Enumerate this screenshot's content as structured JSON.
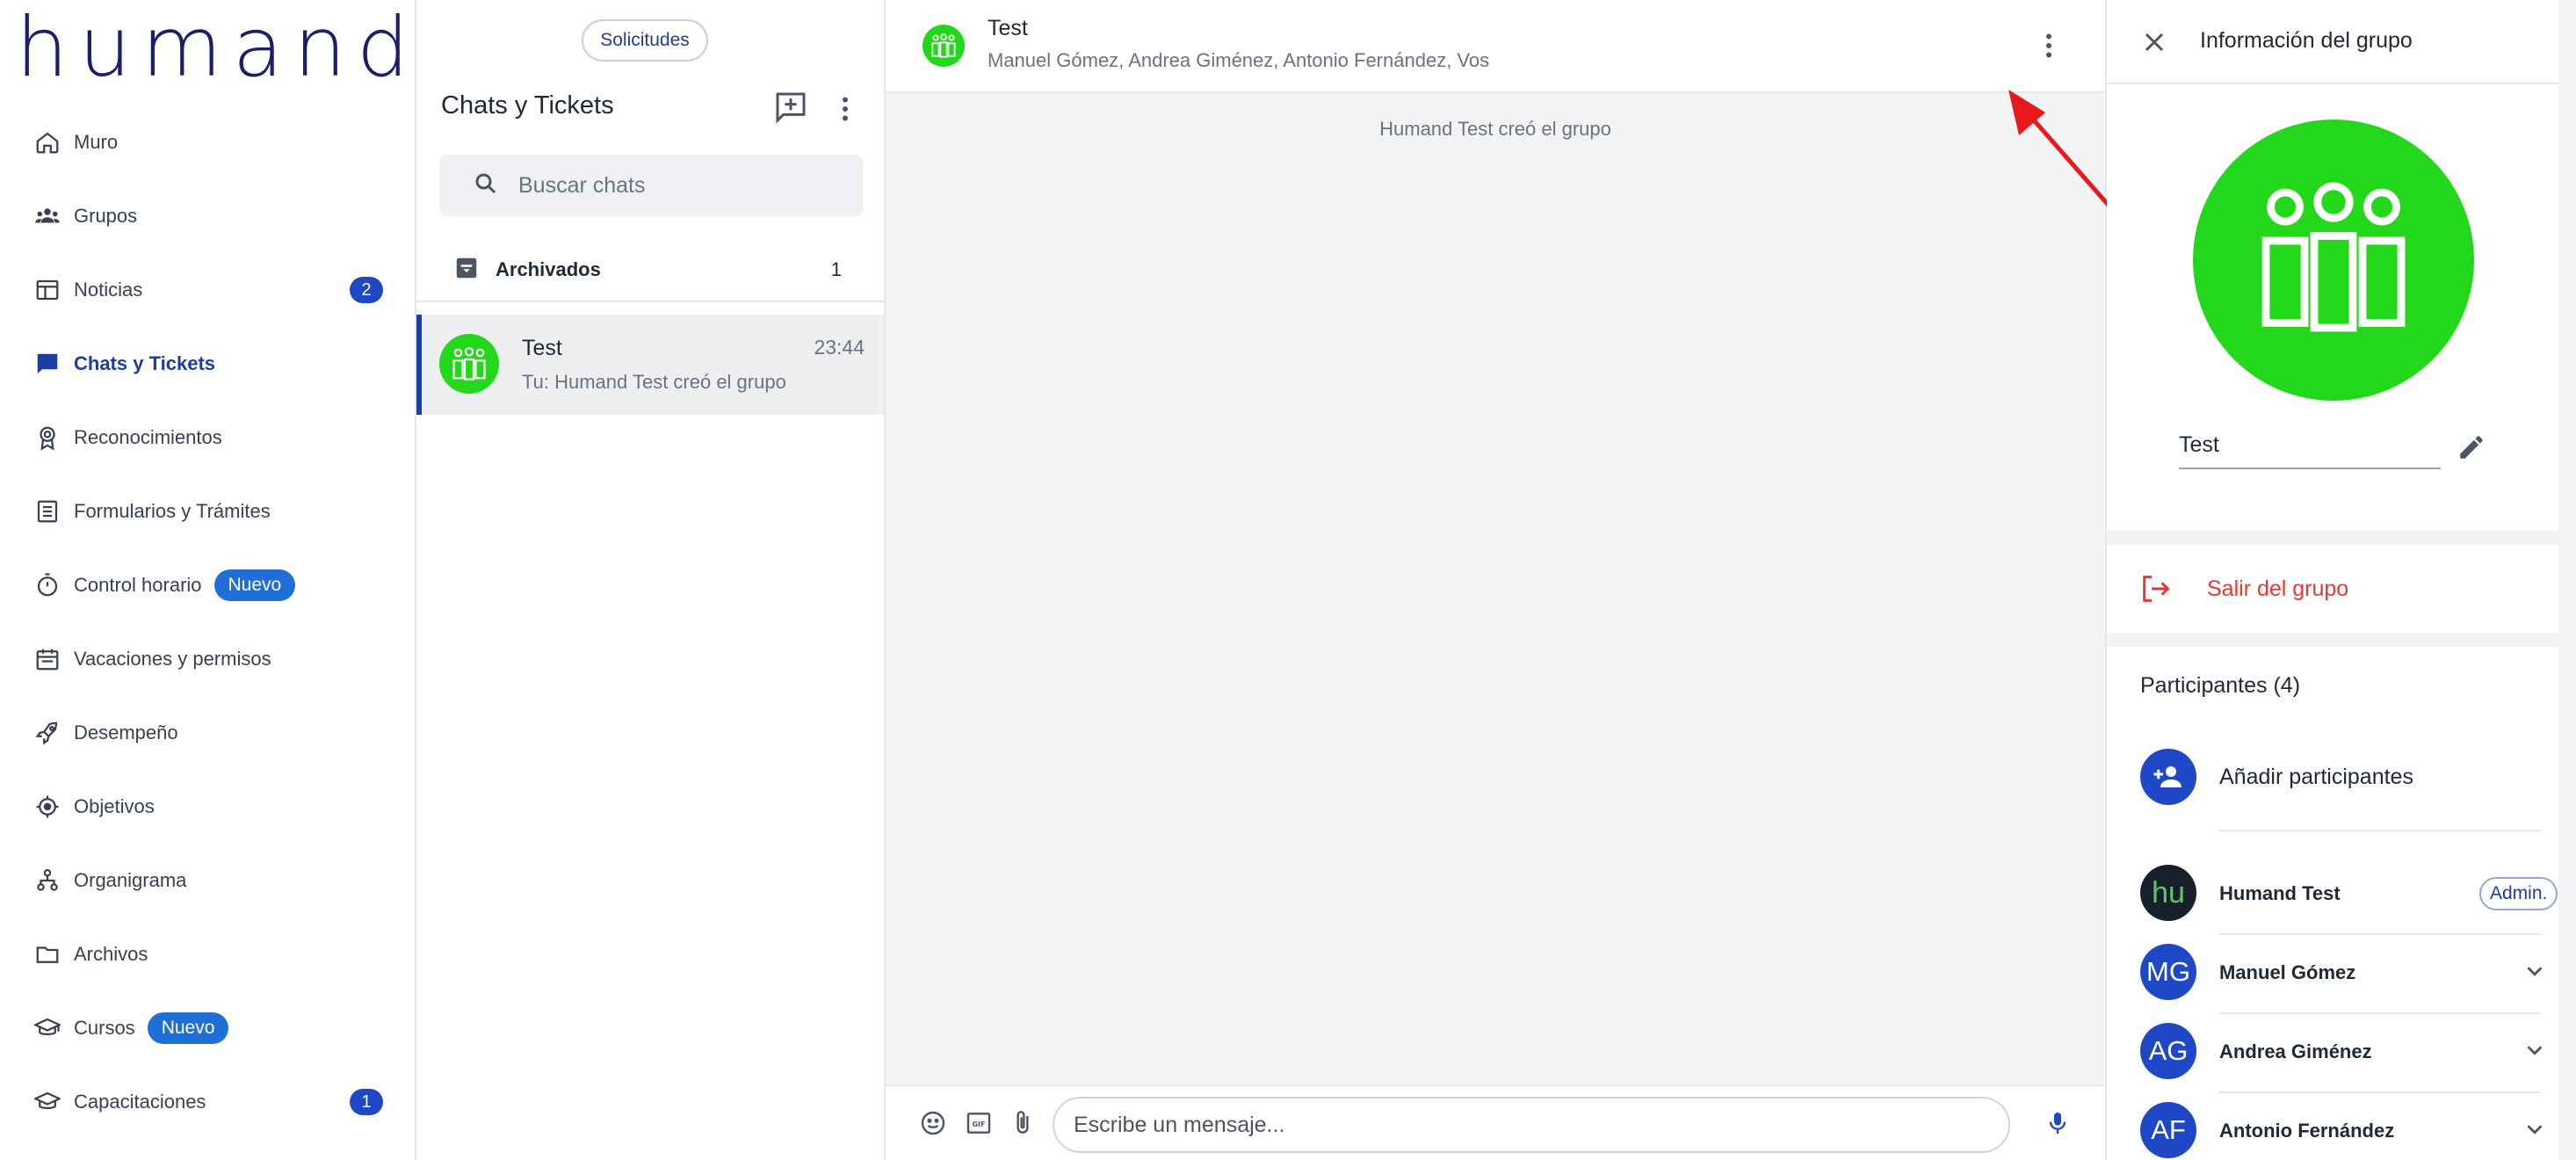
{
  "sidebar": {
    "logo_text": "humand",
    "brand_color": "#1b1f6a",
    "items": [
      {
        "label": "Muro",
        "icon": "home-icon"
      },
      {
        "label": "Grupos",
        "icon": "groups-icon"
      },
      {
        "label": "Noticias",
        "icon": "news-icon",
        "badge": "2"
      },
      {
        "label": "Chats y Tickets",
        "icon": "chat-icon",
        "active": true
      },
      {
        "label": "Reconocimientos",
        "icon": "award-icon"
      },
      {
        "label": "Formularios y Trámites",
        "icon": "form-icon"
      },
      {
        "label": "Control horario",
        "icon": "timer-icon",
        "new_badge": "Nuevo"
      },
      {
        "label": "Vacaciones y permisos",
        "icon": "calendar-icon"
      },
      {
        "label": "Desempeño",
        "icon": "rocket-icon"
      },
      {
        "label": "Objetivos",
        "icon": "target-icon"
      },
      {
        "label": "Organigrama",
        "icon": "org-chart-icon"
      },
      {
        "label": "Archivos",
        "icon": "folder-icon"
      },
      {
        "label": "Cursos",
        "icon": "graduation-cap-icon",
        "new_badge": "Nuevo"
      },
      {
        "label": "Capacitaciones",
        "icon": "training-icon",
        "badge": "1"
      }
    ]
  },
  "chat_list": {
    "requests_button": "Solicitudes",
    "title": "Chats y Tickets",
    "search_placeholder": "Buscar chats",
    "archived": {
      "label": "Archivados",
      "count": "1"
    },
    "chats": [
      {
        "name": "Test",
        "time": "23:44",
        "preview": "Tu: Humand Test creó el grupo",
        "avatar_color": "#23d81b"
      }
    ]
  },
  "conversation": {
    "title": "Test",
    "members": "Manuel Gómez, Andrea Giménez, Antonio Fernández, Vos",
    "system_message": "Humand Test creó el grupo",
    "message_placeholder": "Escribe un mensaje...",
    "annotation_arrow_color": "#e8191c"
  },
  "info_panel": {
    "title": "Información del grupo",
    "group_name": "Test",
    "leave_label": "Salir del grupo",
    "participants_title": "Participantes (4)",
    "add_label": "Añadir participantes",
    "admin_label": "Admin.",
    "members": [
      {
        "name": "Humand Test",
        "initials": "hu",
        "admin": true
      },
      {
        "name": "Manuel Gómez",
        "initials": "MG"
      },
      {
        "name": "Andrea Giménez",
        "initials": "AG"
      },
      {
        "name": "Antonio Fernández",
        "initials": "AF"
      }
    ]
  },
  "colors": {
    "accent": "#1f48c6",
    "active_nav": "#1b3ea6",
    "group_avatar": "#23d81b",
    "danger": "#e53935"
  }
}
